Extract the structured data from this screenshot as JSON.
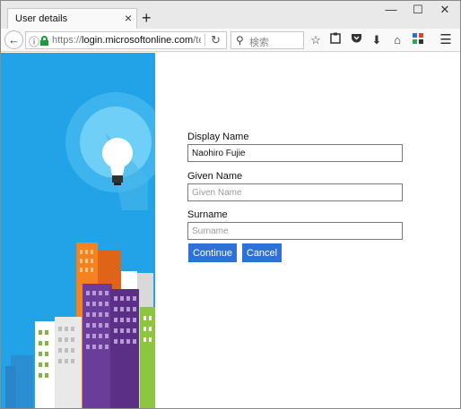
{
  "browser": {
    "tab_title": "User details",
    "tab_close": "×",
    "new_tab": "+",
    "window_controls": {
      "minimize": "—",
      "maximize": "☐",
      "close": "✕"
    },
    "url_scheme": "https://",
    "url_host": "login.microsoftonline.com",
    "url_rest": "/te/",
    "search_placeholder": "検索",
    "icons": {
      "back": "back-arrow-icon",
      "info": "info-icon",
      "lock": "lock-icon",
      "reload": "reload-icon",
      "search": "search-icon",
      "bookmark": "star-icon",
      "reading": "clipboard-icon",
      "pocket": "pocket-icon",
      "downloads": "download-icon",
      "home": "home-icon",
      "extension": "puzzle-icon",
      "menu": "hamburger-menu-icon"
    }
  },
  "form": {
    "display_name": {
      "label": "Display Name",
      "value": "Naohiro Fujie",
      "placeholder": ""
    },
    "given_name": {
      "label": "Given Name",
      "value": "",
      "placeholder": "Given Name"
    },
    "surname": {
      "label": "Surname",
      "value": "",
      "placeholder": "Surname"
    },
    "continue_label": "Continue",
    "cancel_label": "Cancel"
  },
  "colors": {
    "accent": "#2e72d8",
    "panel_blue": "#22a3e8",
    "lock_green": "#1a9c3a"
  }
}
